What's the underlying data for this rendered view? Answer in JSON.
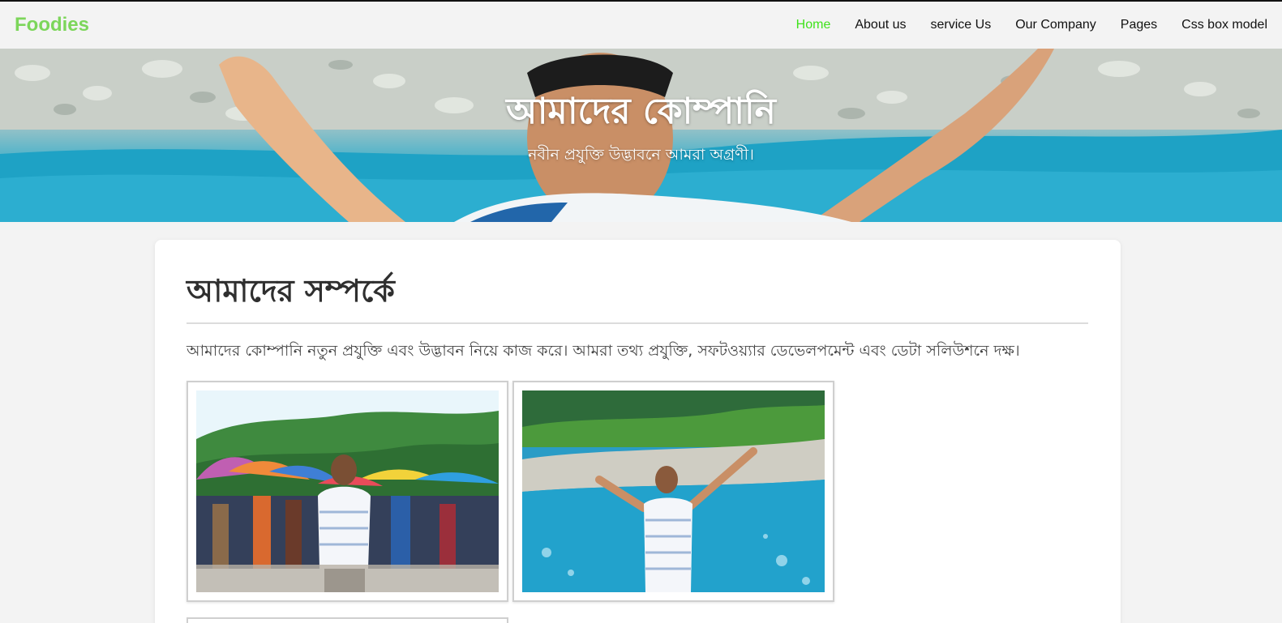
{
  "nav": {
    "brand": "Foodies",
    "links": [
      {
        "label": "Home",
        "active": true
      },
      {
        "label": "About us",
        "active": false
      },
      {
        "label": "service Us",
        "active": false
      },
      {
        "label": "Our Company",
        "active": false
      },
      {
        "label": "Pages",
        "active": false
      },
      {
        "label": "Css box model",
        "active": false
      }
    ]
  },
  "hero": {
    "title": "আমাদের কোম্পানি",
    "subtitle": "নবীন প্রযুক্তি উদ্ভাবনে আমরা অগ্রণী।"
  },
  "about": {
    "heading": "আমাদের সম্পর্কে",
    "text": "আমাদের কোম্পানি নতুন প্রযুক্তি এবং উদ্ভাবন নিয়ে কাজ করে। আমরা তথ্য প্রযুক্তি, সফটওয়্যার ডেভেলপমেন্ট এবং ডেটা সলিউশনে দক্ষ।"
  },
  "colors": {
    "brand": "#7cd65a",
    "active_link": "#3fe21b",
    "page_bg": "#f3f3f3"
  }
}
